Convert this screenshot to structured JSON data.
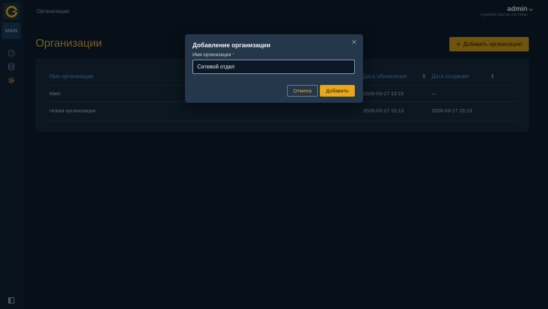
{
  "sidebar": {
    "main_tag": "MAIN",
    "icons": [
      "dashboard-icon",
      "database-icon",
      "settings-icon",
      "panel-toggle-icon"
    ]
  },
  "header": {
    "breadcrumb": "Организации",
    "user_name": "admin",
    "user_role": "Администратор системы"
  },
  "page": {
    "title": "Организации",
    "add_button": "Добавить организацию"
  },
  "table": {
    "columns": [
      "Имя организации",
      "Дата обновления",
      "Дата создания"
    ],
    "rows": [
      [
        "Main",
        "2026-03-17 13:15",
        "—"
      ],
      [
        "Новая организация",
        "2026-03-17 15:13",
        "2026-03-17 15:13"
      ]
    ]
  },
  "modal": {
    "title": "Добавление организации",
    "field_label": "Имя организации",
    "required_mark": "*",
    "field_value": "Сетевой отдел",
    "cancel": "Отмена",
    "submit": "Добавить"
  },
  "colors": {
    "accent": "#e8a817",
    "link": "#4f8edc",
    "background": "#0b1622"
  }
}
